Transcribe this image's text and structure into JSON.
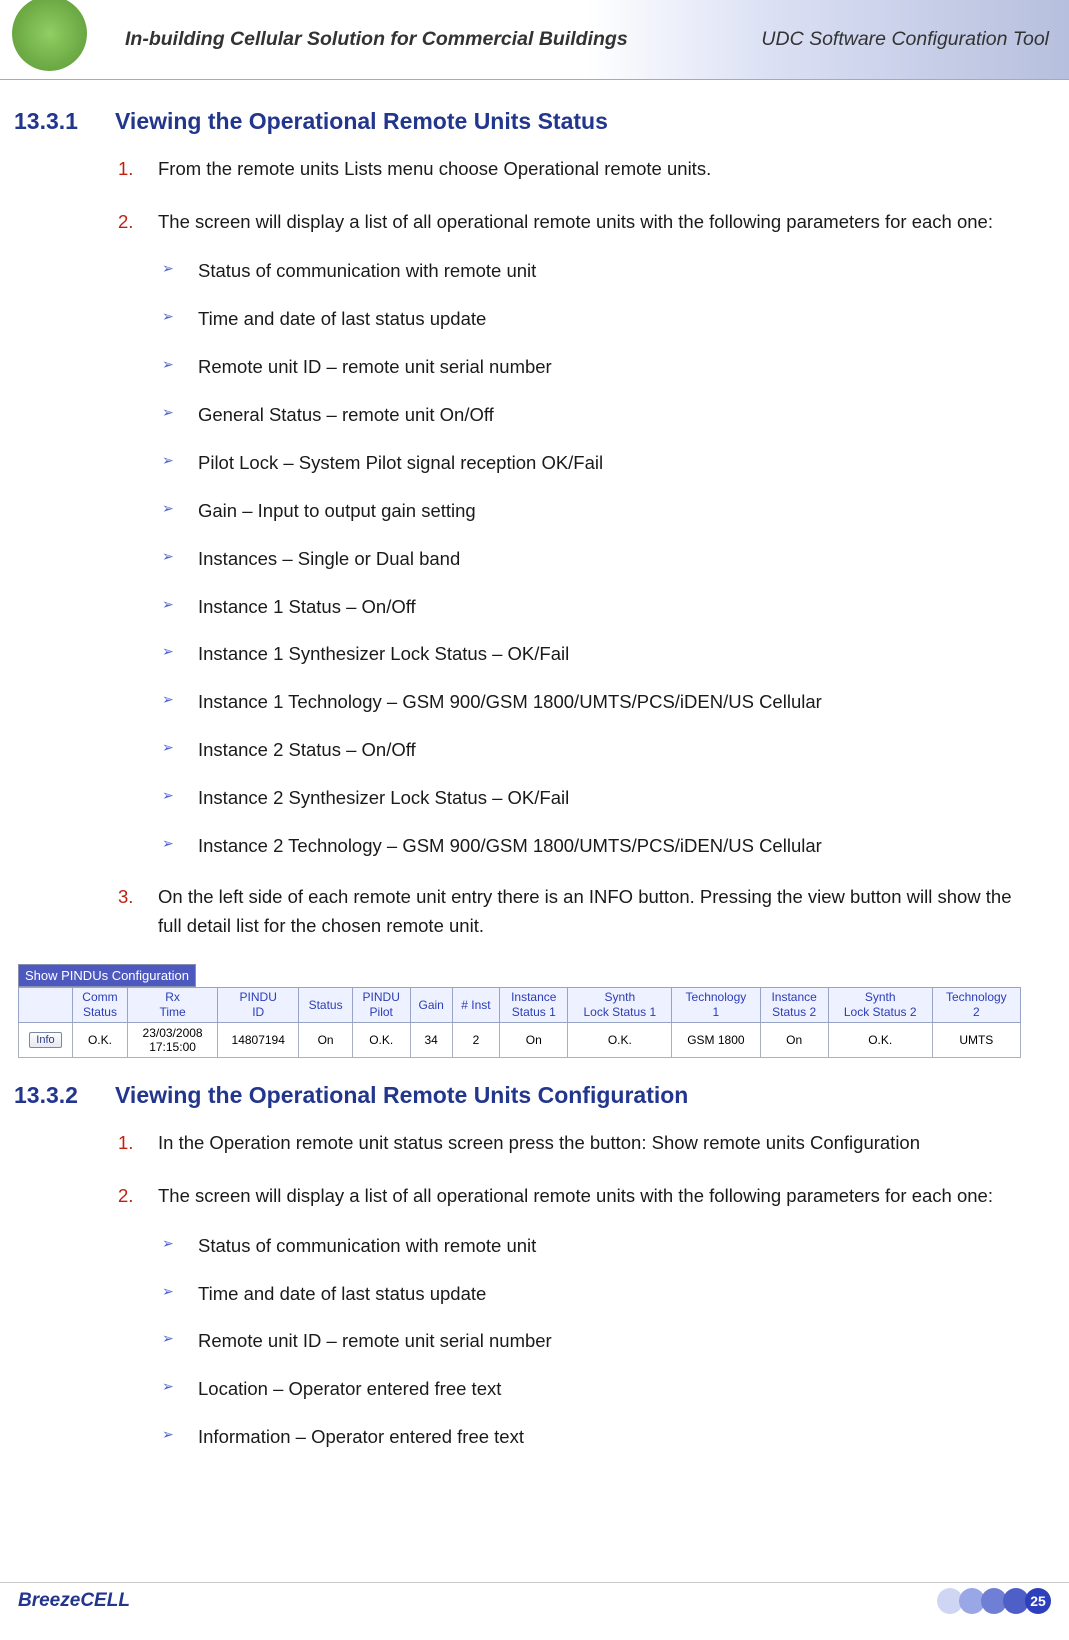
{
  "header": {
    "left": "In-building Cellular Solution for Commercial Buildings",
    "right": "UDC Software Configuration Tool"
  },
  "section1": {
    "num": "13.3.1",
    "title": "Viewing the Operational Remote Units Status",
    "steps": [
      {
        "n": "1.",
        "text": "From the remote units Lists menu choose Operational remote units."
      },
      {
        "n": "2.",
        "text": "The screen will display a list of all operational remote units with the following parameters for each one:",
        "sub": [
          "Status of communication with remote unit",
          "Time and date of last status update",
          "Remote unit ID – remote unit serial number",
          "General Status – remote unit On/Off",
          "Pilot Lock – System Pilot signal reception OK/Fail",
          "Gain – Input to output gain setting",
          "Instances – Single or Dual band",
          "Instance 1 Status – On/Off",
          "Instance 1 Synthesizer Lock Status – OK/Fail",
          "Instance 1 Technology – GSM 900/GSM 1800/UMTS/PCS/iDEN/US Cellular",
          "Instance 2 Status – On/Off",
          "Instance 2 Synthesizer Lock Status – OK/Fail",
          "Instance 2 Technology – GSM 900/GSM 1800/UMTS/PCS/iDEN/US Cellular"
        ]
      },
      {
        "n": "3.",
        "text": "On the left side of each remote unit entry there is an INFO button. Pressing the view button will show the full detail list for the chosen remote unit."
      }
    ]
  },
  "table": {
    "caption": "Show PINDUs Configuration",
    "headers": [
      "",
      "Comm Status",
      "Rx Time",
      "PINDU ID",
      "Status",
      "PINDU Pilot",
      "Gain",
      "# Inst",
      "Instance Status 1",
      "Synth Lock Status 1",
      "Technology 1",
      "Instance Status 2",
      "Synth Lock Status 2",
      "Technology 2"
    ],
    "info_label": "Info",
    "row": [
      "O.K.",
      "23/03/2008 17:15:00",
      "14807194",
      "On",
      "O.K.",
      "34",
      "2",
      "On",
      "O.K.",
      "GSM 1800",
      "On",
      "O.K.",
      "UMTS"
    ]
  },
  "section2": {
    "num": "13.3.2",
    "title": "Viewing the Operational Remote Units Configuration",
    "steps": [
      {
        "n": "1.",
        "text": "In the Operation remote unit status screen press the button: Show remote units Configuration"
      },
      {
        "n": "2.",
        "text": "The screen will display a list of all operational remote units with the following parameters for each one:",
        "sub": [
          "Status of communication with remote unit",
          "Time and date of last status update",
          "Remote unit ID – remote unit serial number",
          "Location – Operator entered free text",
          "Information – Operator entered free text"
        ]
      }
    ]
  },
  "footer": {
    "brand": "BreezeCELL",
    "page": "25"
  }
}
